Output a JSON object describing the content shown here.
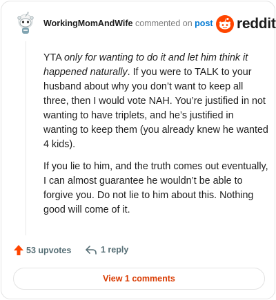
{
  "header": {
    "username": "WorkingMomAndWife",
    "action_text": "commented on",
    "post_link": "post",
    "brand": "reddit",
    "avatar_icon": "snoo-avatar-icon",
    "brand_icon": "reddit-alien-icon"
  },
  "comment": {
    "p1_prefix": "YTA ",
    "p1_italic": "only for wanting to do it and let him think it happened naturally",
    "p1_rest": ". If you were to TALK to your husband about why you don’t want to keep all three, then I would vote NAH. You’re justified in not wanting to have triplets, and he’s justified in wanting to keep them (you already knew he wanted 4 kids).",
    "p2": "If you lie to him, and the truth comes out eventually, I can almost guarantee he wouldn’t be able to forgive you. Do not lie to him about this. Nothing good will come of it."
  },
  "actions": {
    "upvotes": "53 upvotes",
    "replies": "1 reply",
    "upvote_icon": "upvote-arrow-icon",
    "reply_icon": "reply-arrow-icon"
  },
  "footer": {
    "view_comments": "View 1 comments"
  },
  "colors": {
    "brand": "#ff4500",
    "link": "#0079d3",
    "view_button_text": "#d93a00",
    "muted": "#576f76"
  }
}
